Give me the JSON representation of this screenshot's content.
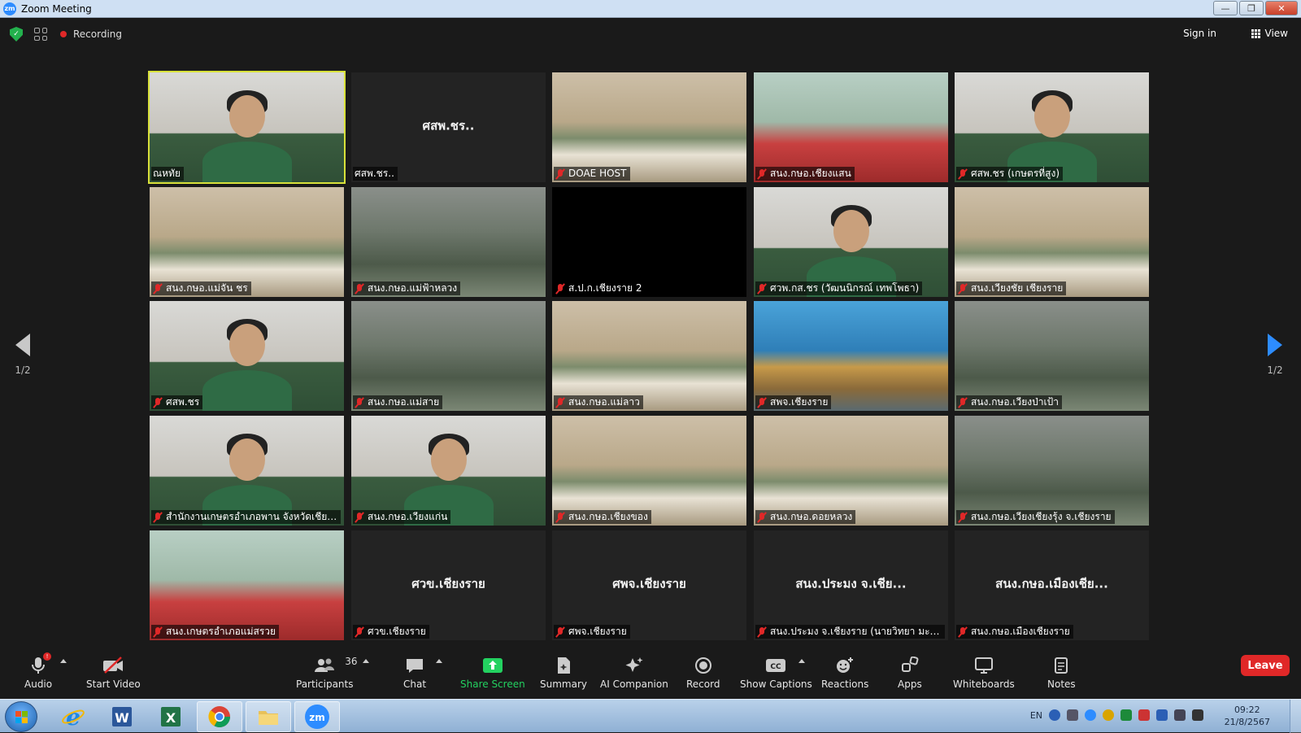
{
  "window": {
    "title": "Zoom Meeting",
    "minimize": "—",
    "restore": "❐",
    "close": "✕"
  },
  "topbar": {
    "recording_label": "Recording",
    "signin_label": "Sign in",
    "view_label": "View"
  },
  "pagination": {
    "left_page": "1/2",
    "right_page": "1/2"
  },
  "tiles": [
    {
      "label": "ณหทัย",
      "big": "",
      "muted": false,
      "active": true,
      "scene": "person"
    },
    {
      "label": "ศสพ.ชร..",
      "big": "ศสพ.ชร..",
      "muted": false,
      "active": false,
      "scene": "none"
    },
    {
      "label": "DOAE HOST",
      "big": "",
      "muted": true,
      "active": false,
      "scene": "meeting"
    },
    {
      "label": "สนง.กษอ.เชียงแสน",
      "big": "",
      "muted": true,
      "active": false,
      "scene": "room"
    },
    {
      "label": "ศสพ.ชร (เกษตรที่สูง)",
      "big": "",
      "muted": true,
      "active": false,
      "scene": "person"
    },
    {
      "label": "สนง.กษอ.แม่จัน ชร",
      "big": "",
      "muted": true,
      "active": false,
      "scene": "meeting"
    },
    {
      "label": "สนง.กษอ.แม่ฟ้าหลวง",
      "big": "",
      "muted": true,
      "active": false,
      "scene": "office"
    },
    {
      "label": "ส.ป.ก.เชียงราย 2",
      "big": "",
      "muted": true,
      "active": false,
      "scene": "black"
    },
    {
      "label": "ศวพ.กส.ชร (วัฒนนิกรณ์ เทพโพธา)",
      "big": "",
      "muted": true,
      "active": false,
      "scene": "person"
    },
    {
      "label": "สนง.เวียงชัย เชียงราย",
      "big": "",
      "muted": true,
      "active": false,
      "scene": "meeting"
    },
    {
      "label": "ศสพ.ชร",
      "big": "",
      "muted": true,
      "active": false,
      "scene": "person"
    },
    {
      "label": "สนง.กษอ.แม่สาย",
      "big": "",
      "muted": true,
      "active": false,
      "scene": "office"
    },
    {
      "label": "สนง.กษอ.แม่ลาว",
      "big": "",
      "muted": true,
      "active": false,
      "scene": "meeting"
    },
    {
      "label": "สพจ.เชียงราย",
      "big": "",
      "muted": true,
      "active": false,
      "scene": "banner"
    },
    {
      "label": "สนง.กษอ.เวียงป่าเป้า",
      "big": "",
      "muted": true,
      "active": false,
      "scene": "office"
    },
    {
      "label": "สำนักงานเกษตรอำเภอพาน จังหวัดเชียงราย",
      "big": "",
      "muted": true,
      "active": false,
      "scene": "person"
    },
    {
      "label": "สนง.กษอ.เวียงแก่น",
      "big": "",
      "muted": true,
      "active": false,
      "scene": "person"
    },
    {
      "label": "สนง.กษอ.เชียงของ",
      "big": "",
      "muted": true,
      "active": false,
      "scene": "meeting"
    },
    {
      "label": "สนง.กษอ.ดอยหลวง",
      "big": "",
      "muted": true,
      "active": false,
      "scene": "meeting"
    },
    {
      "label": "สนง.กษอ.เวียงเชียงรุ้ง จ.เชียงราย",
      "big": "",
      "muted": true,
      "active": false,
      "scene": "office"
    },
    {
      "label": "สนง.เกษตรอำเภอแม่สรวย",
      "big": "",
      "muted": true,
      "active": false,
      "scene": "room"
    },
    {
      "label": "ศวข.เชียงราย",
      "big": "ศวข.เชียงราย",
      "muted": true,
      "active": false,
      "scene": "none"
    },
    {
      "label": "ศพจ.เชียงราย",
      "big": "ศพจ.เชียงราย",
      "muted": true,
      "active": false,
      "scene": "none"
    },
    {
      "label": "สนง.ประมง จ.เชียงราย (นายวิทยา มะสะ...",
      "big": "สนง.ประมง จ.เชีย...",
      "muted": true,
      "active": false,
      "scene": "none"
    },
    {
      "label": "สนง.กษอ.เมืองเชียงราย",
      "big": "สนง.กษอ.เมืองเชีย...",
      "muted": true,
      "active": false,
      "scene": "none"
    }
  ],
  "toolbar": {
    "audio": "Audio",
    "start_video": "Start Video",
    "participants": "Participants",
    "participants_count": "36",
    "chat": "Chat",
    "share_screen": "Share Screen",
    "summary": "Summary",
    "ai_companion": "AI Companion",
    "record": "Record",
    "show_captions": "Show Captions",
    "reactions": "Reactions",
    "apps": "Apps",
    "whiteboards": "Whiteboards",
    "notes": "Notes",
    "leave": "Leave",
    "share_color": "#23d160",
    "leave_color": "#e02828"
  },
  "taskbar": {
    "apps": [
      "internet-explorer",
      "word",
      "excel",
      "chrome",
      "file-explorer",
      "zoom"
    ],
    "language": "EN",
    "time": "09:22",
    "date": "21/8/2567"
  }
}
